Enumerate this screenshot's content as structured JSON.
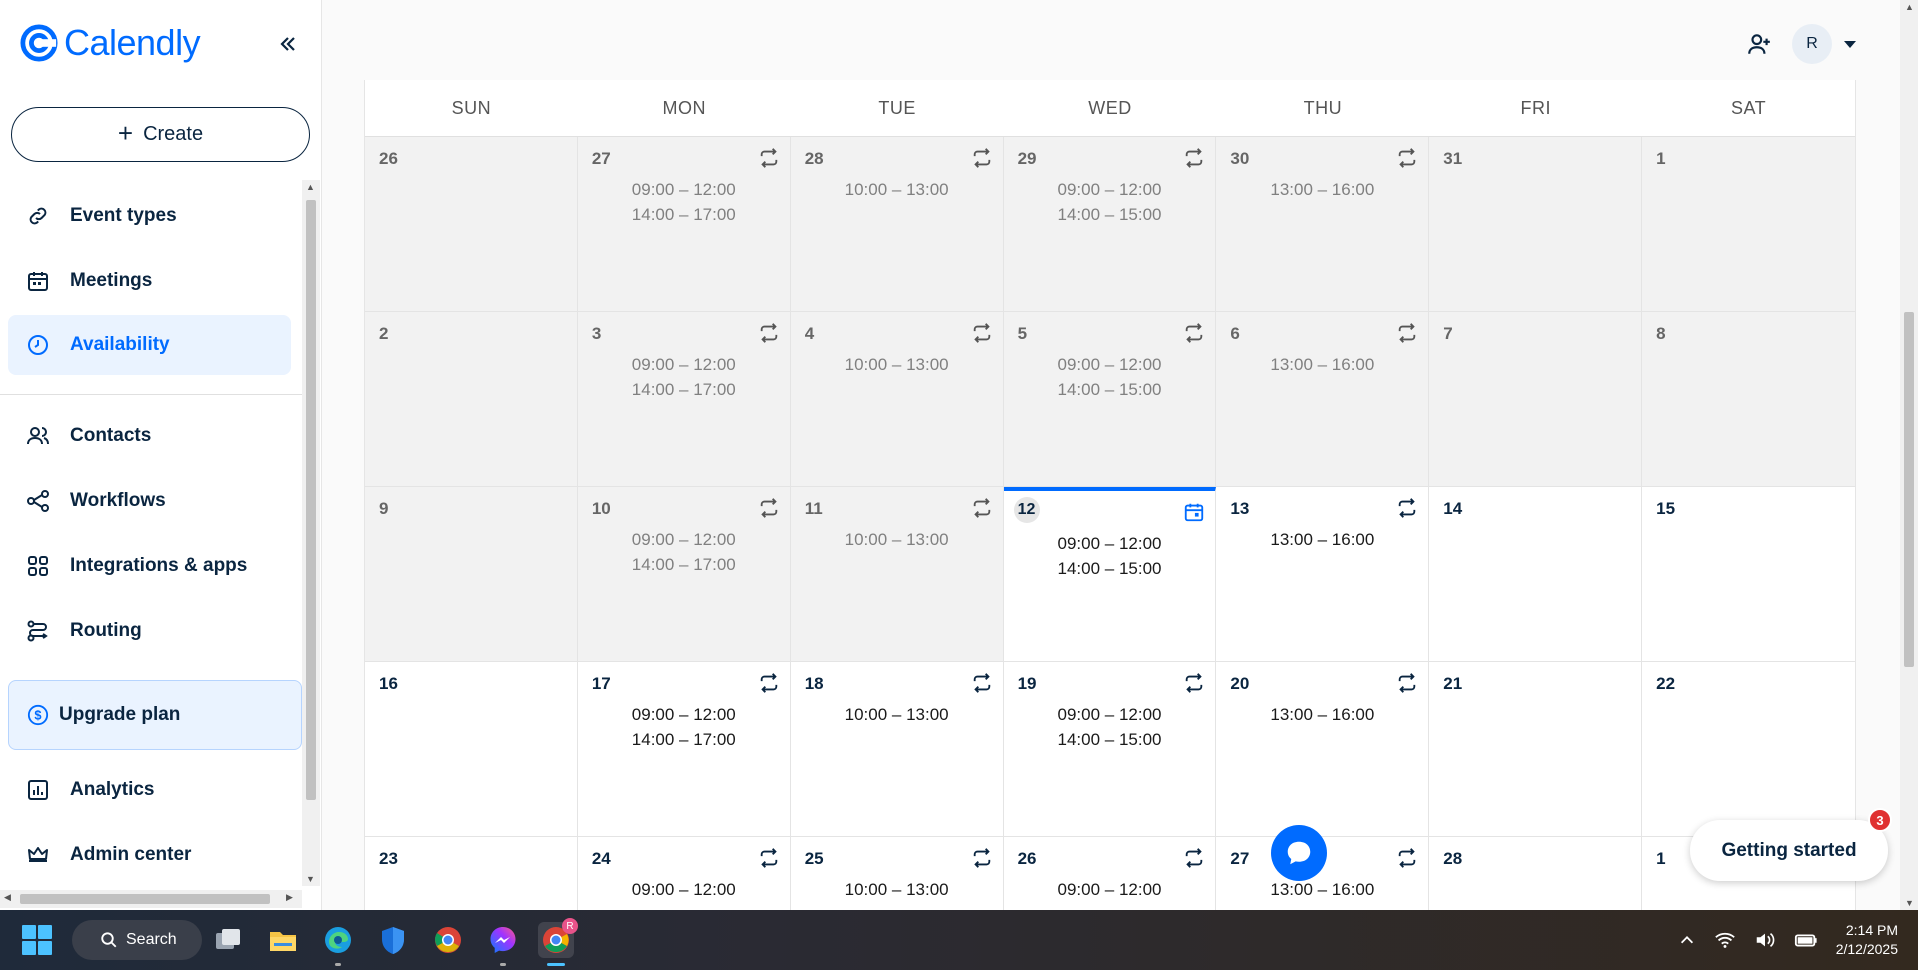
{
  "brand": {
    "name": "Calendly",
    "accent": "#006bff"
  },
  "sidebar": {
    "create_label": "Create",
    "items": [
      {
        "label": "Event types",
        "icon": "link-icon",
        "active": false
      },
      {
        "label": "Meetings",
        "icon": "calendar-icon",
        "active": false
      },
      {
        "label": "Availability",
        "icon": "clock-icon",
        "active": true
      },
      {
        "label": "Contacts",
        "icon": "contacts-icon",
        "active": false
      },
      {
        "label": "Workflows",
        "icon": "workflow-icon",
        "active": false
      },
      {
        "label": "Integrations & apps",
        "icon": "grid-icon",
        "active": false
      },
      {
        "label": "Routing",
        "icon": "routing-icon",
        "active": false
      },
      {
        "label": "Analytics",
        "icon": "chart-icon",
        "active": false
      },
      {
        "label": "Admin center",
        "icon": "crown-icon",
        "active": false
      }
    ],
    "upgrade_label": "Upgrade plan"
  },
  "header": {
    "avatar_initial": "R"
  },
  "calendar": {
    "weekdays": [
      "SUN",
      "MON",
      "TUE",
      "WED",
      "THU",
      "FRI",
      "SAT"
    ],
    "weeks": [
      [
        {
          "day": "26",
          "past": true,
          "repeat": false,
          "times": []
        },
        {
          "day": "27",
          "past": true,
          "repeat": true,
          "times": [
            "09:00 – 12:00",
            "14:00 – 17:00"
          ]
        },
        {
          "day": "28",
          "past": true,
          "repeat": true,
          "times": [
            "10:00 – 13:00"
          ]
        },
        {
          "day": "29",
          "past": true,
          "repeat": true,
          "times": [
            "09:00 – 12:00",
            "14:00 – 15:00"
          ]
        },
        {
          "day": "30",
          "past": true,
          "repeat": true,
          "times": [
            "13:00 – 16:00"
          ]
        },
        {
          "day": "31",
          "past": true,
          "repeat": false,
          "times": []
        },
        {
          "day": "1",
          "past": true,
          "repeat": false,
          "times": []
        }
      ],
      [
        {
          "day": "2",
          "past": true,
          "repeat": false,
          "times": []
        },
        {
          "day": "3",
          "past": true,
          "repeat": true,
          "times": [
            "09:00 – 12:00",
            "14:00 – 17:00"
          ]
        },
        {
          "day": "4",
          "past": true,
          "repeat": true,
          "times": [
            "10:00 – 13:00"
          ]
        },
        {
          "day": "5",
          "past": true,
          "repeat": true,
          "times": [
            "09:00 – 12:00",
            "14:00 – 15:00"
          ]
        },
        {
          "day": "6",
          "past": true,
          "repeat": true,
          "times": [
            "13:00 – 16:00"
          ]
        },
        {
          "day": "7",
          "past": true,
          "repeat": false,
          "times": []
        },
        {
          "day": "8",
          "past": true,
          "repeat": false,
          "times": []
        }
      ],
      [
        {
          "day": "9",
          "past": true,
          "repeat": false,
          "times": []
        },
        {
          "day": "10",
          "past": true,
          "repeat": true,
          "times": [
            "09:00 – 12:00",
            "14:00 – 17:00"
          ]
        },
        {
          "day": "11",
          "past": true,
          "repeat": true,
          "times": [
            "10:00 – 13:00"
          ]
        },
        {
          "day": "12",
          "past": false,
          "today": true,
          "repeat": false,
          "override": true,
          "times": [
            "09:00 – 12:00",
            "14:00 – 15:00"
          ]
        },
        {
          "day": "13",
          "past": false,
          "repeat": true,
          "times": [
            "13:00 – 16:00"
          ]
        },
        {
          "day": "14",
          "past": false,
          "repeat": false,
          "times": []
        },
        {
          "day": "15",
          "past": false,
          "repeat": false,
          "times": []
        }
      ],
      [
        {
          "day": "16",
          "past": false,
          "repeat": false,
          "times": []
        },
        {
          "day": "17",
          "past": false,
          "repeat": true,
          "times": [
            "09:00 – 12:00",
            "14:00 – 17:00"
          ]
        },
        {
          "day": "18",
          "past": false,
          "repeat": true,
          "times": [
            "10:00 – 13:00"
          ]
        },
        {
          "day": "19",
          "past": false,
          "repeat": true,
          "times": [
            "09:00 – 12:00",
            "14:00 – 15:00"
          ]
        },
        {
          "day": "20",
          "past": false,
          "repeat": true,
          "times": [
            "13:00 – 16:00"
          ]
        },
        {
          "day": "21",
          "past": false,
          "repeat": false,
          "times": []
        },
        {
          "day": "22",
          "past": false,
          "repeat": false,
          "times": []
        }
      ],
      [
        {
          "day": "23",
          "past": false,
          "repeat": false,
          "times": []
        },
        {
          "day": "24",
          "past": false,
          "repeat": true,
          "times": [
            "09:00 – 12:00"
          ]
        },
        {
          "day": "25",
          "past": false,
          "repeat": true,
          "times": [
            "10:00 – 13:00"
          ]
        },
        {
          "day": "26",
          "past": false,
          "repeat": true,
          "times": [
            "09:00 – 12:00"
          ]
        },
        {
          "day": "27",
          "past": false,
          "repeat": true,
          "times": [
            "13:00 – 16:00"
          ]
        },
        {
          "day": "28",
          "past": false,
          "repeat": false,
          "times": []
        },
        {
          "day": "1",
          "past": false,
          "repeat": false,
          "times": []
        }
      ]
    ]
  },
  "widgets": {
    "getting_started_label": "Getting started",
    "getting_started_badge": "3"
  },
  "taskbar": {
    "search_label": "Search",
    "time": "2:14 PM",
    "date": "2/12/2025",
    "chrome_badge": "R"
  }
}
